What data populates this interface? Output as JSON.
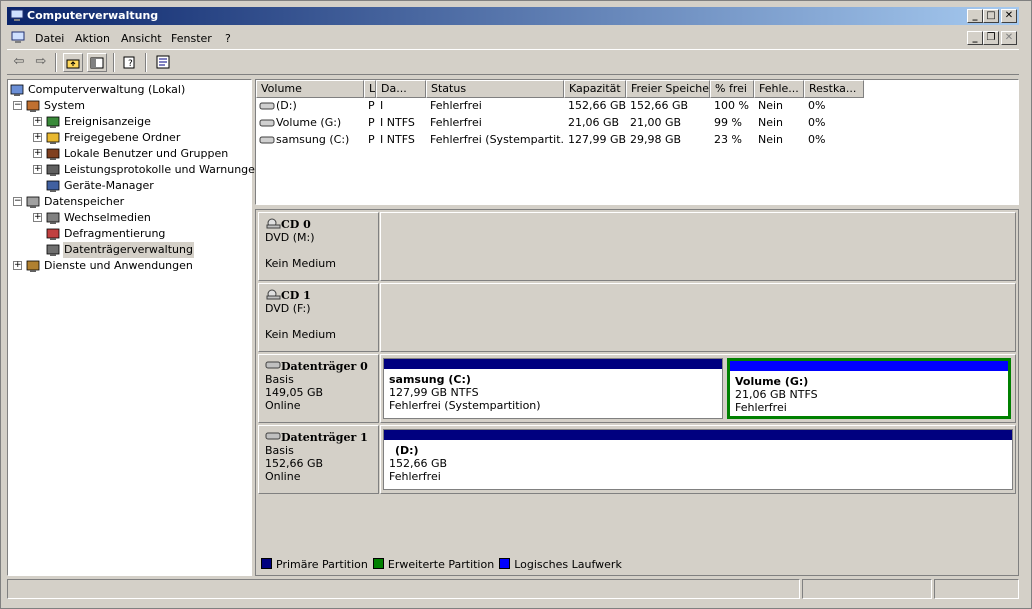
{
  "window": {
    "title": "Computerverwaltung"
  },
  "menu": [
    "Datei",
    "Aktion",
    "Ansicht",
    "Fenster",
    "?"
  ],
  "toolbar": {
    "back_icon": "back-arrow-icon",
    "forward_icon": "forward-arrow-icon",
    "buttons": [
      "up-folder-icon",
      "show-hide-tree-icon",
      "help-icon",
      "properties-icon"
    ]
  },
  "tree": [
    {
      "label": "Computerverwaltung (Lokal)",
      "level": 0,
      "expander": "",
      "icon": "computer-icon"
    },
    {
      "label": "System",
      "level": 1,
      "expander": "−",
      "icon": "system-tools-icon"
    },
    {
      "label": "Ereignisanzeige",
      "level": 2,
      "expander": "+",
      "icon": "event-viewer-icon"
    },
    {
      "label": "Freigegebene Ordner",
      "level": 2,
      "expander": "+",
      "icon": "shared-folder-icon"
    },
    {
      "label": "Lokale Benutzer und Gruppen",
      "level": 2,
      "expander": "+",
      "icon": "users-icon"
    },
    {
      "label": "Leistungsprotokolle und Warnungen",
      "level": 2,
      "expander": "+",
      "icon": "performance-icon"
    },
    {
      "label": "Geräte-Manager",
      "level": 2,
      "expander": "",
      "icon": "device-manager-icon"
    },
    {
      "label": "Datenspeicher",
      "level": 1,
      "expander": "−",
      "icon": "storage-icon"
    },
    {
      "label": "Wechselmedien",
      "level": 2,
      "expander": "+",
      "icon": "removable-media-icon"
    },
    {
      "label": "Defragmentierung",
      "level": 2,
      "expander": "",
      "icon": "defrag-icon"
    },
    {
      "label": "Datenträgerverwaltung",
      "level": 2,
      "expander": "",
      "icon": "disk-management-icon",
      "selected": true
    },
    {
      "label": "Dienste und Anwendungen",
      "level": 1,
      "expander": "+",
      "icon": "services-icon"
    }
  ],
  "volume_list": {
    "columns": [
      "Volume",
      "L",
      "Da...",
      "Status",
      "Kapazität",
      "Freier Speicher",
      "% frei",
      "Fehle...",
      "Restka..."
    ],
    "rows": [
      [
        "(D:)",
        "P",
        "I",
        "Fehlerfrei",
        "152,66 GB",
        "152,66 GB",
        "100 %",
        "Nein",
        "0%"
      ],
      [
        "Volume (G:)",
        "P",
        "I NTFS",
        "Fehlerfrei",
        "21,06 GB",
        "21,00 GB",
        "99 %",
        "Nein",
        "0%"
      ],
      [
        "samsung (C:)",
        "P",
        "I NTFS",
        "Fehlerfrei (Systempartit...",
        "127,99 GB",
        "29,98 GB",
        "23 %",
        "Nein",
        "0%"
      ]
    ]
  },
  "disks": [
    {
      "name": "CD 0",
      "lines": [
        "DVD (M:)",
        "",
        "Kein Medium"
      ],
      "icon": "cd-drive-icon",
      "partitions": []
    },
    {
      "name": "CD 1",
      "lines": [
        "DVD (F:)",
        "",
        "Kein Medium"
      ],
      "icon": "cd-drive-icon",
      "partitions": []
    },
    {
      "name": "Datenträger 0",
      "lines": [
        "Basis",
        "149,05 GB",
        "Online"
      ],
      "icon": "hard-disk-icon",
      "partitions": [
        {
          "name": "samsung  (C:)",
          "size": "127,99 GB NTFS",
          "status": "Fehlerfrei (Systempartition)",
          "color": "#00007f"
        },
        {
          "name": "Volume  (G:)",
          "size": "21,06 GB NTFS",
          "status": "Fehlerfrei",
          "color": "#0000ff"
        }
      ]
    },
    {
      "name": "Datenträger 1",
      "lines": [
        "Basis",
        "152,66 GB",
        "Online"
      ],
      "icon": "hard-disk-icon",
      "partitions": [
        {
          "name": "(D:)",
          "size": "152,66 GB",
          "status": "Fehlerfrei",
          "color": "#00007f"
        }
      ]
    }
  ],
  "legend": [
    {
      "label": "Primäre Partition",
      "color": "#00007f"
    },
    {
      "label": "Erweiterte Partition",
      "color": "#008000"
    },
    {
      "label": "Logisches Laufwerk",
      "color": "#0000ff"
    }
  ],
  "colors": {
    "titlebar_start": "#0a246a",
    "titlebar_end": "#a6caf0",
    "selection_border": "#008000"
  }
}
